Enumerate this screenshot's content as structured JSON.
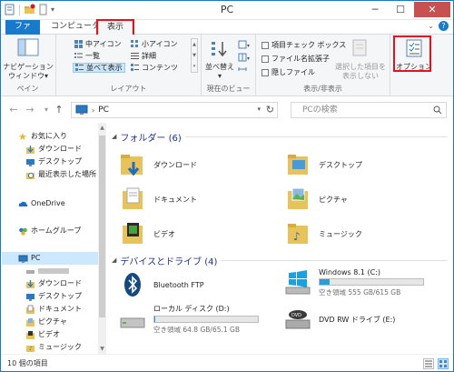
{
  "window": {
    "title": "PC",
    "minimize": "─",
    "maximize": "☐",
    "close": "✕"
  },
  "tabs": {
    "file": "ファイル",
    "computer": "コンピューター",
    "view": "表示"
  },
  "ribbon": {
    "pane": {
      "nav_pane_line1": "ナビゲーション",
      "nav_pane_line2": "ウィンドウ▾",
      "label": "ペイン"
    },
    "layout": {
      "medium_icons": "中アイコン",
      "small_icons": "小アイコン",
      "list": "一覧",
      "details": "詳細",
      "tiles": "並べて表示",
      "content": "コンテンツ",
      "label": "レイアウト"
    },
    "current_view": {
      "sort_by_line1": "並べ替え",
      "sort_by_line2": "▾",
      "label": "現在のビュー"
    },
    "show_hide": {
      "item_checkboxes": "項目チェック ボックス",
      "file_extensions": "ファイル名拡張子",
      "hidden_items": "隠しファイル",
      "hide_selected_line1": "選択した項目を",
      "hide_selected_line2": "表示しない",
      "label": "表示/非表示"
    },
    "options": {
      "label": "オプション"
    }
  },
  "address": {
    "back": "←",
    "forward": "→",
    "recent": "▾",
    "up": "↑",
    "path": "PC",
    "search_placeholder": "PCの検索"
  },
  "nav": {
    "favorites": "お気に入り",
    "downloads": "ダウンロード",
    "desktop": "デスクトップ",
    "recent_places": "最近表示した場所",
    "onedrive": "OneDrive",
    "homegroup": "ホームグループ",
    "pc": "PC",
    "pc_downloads": "ダウンロード",
    "pc_desktop": "デスクトップ",
    "pc_documents": "ドキュメント",
    "pc_pictures": "ピクチャ",
    "pc_videos": "ビデオ",
    "pc_music": "ミュージック"
  },
  "content": {
    "folders_header": "フォルダー (6)",
    "folders": [
      {
        "name": "ダウンロード"
      },
      {
        "name": "デスクトップ"
      },
      {
        "name": "ドキュメント"
      },
      {
        "name": "ピクチャ"
      },
      {
        "name": "ビデオ"
      },
      {
        "name": "ミュージック"
      }
    ],
    "drives_header": "デバイスとドライブ (4)",
    "drives": [
      {
        "name": "Bluetooth FTP"
      },
      {
        "name": "Windows 8.1 (C:)",
        "free": "空き領域 555 GB/615 GB",
        "used_fraction": 0.1
      },
      {
        "name": "ローカル ディスク (D:)",
        "free": "空き領域 64.8 GB/65.1 GB",
        "used_fraction": 0.005
      },
      {
        "name": "DVD RW ドライブ (E:)"
      }
    ]
  },
  "status": {
    "count": "10 個の項目"
  },
  "colors": {
    "accent": "#1979ca",
    "highlight": "#e0141e",
    "folder": "#e8c25a"
  }
}
